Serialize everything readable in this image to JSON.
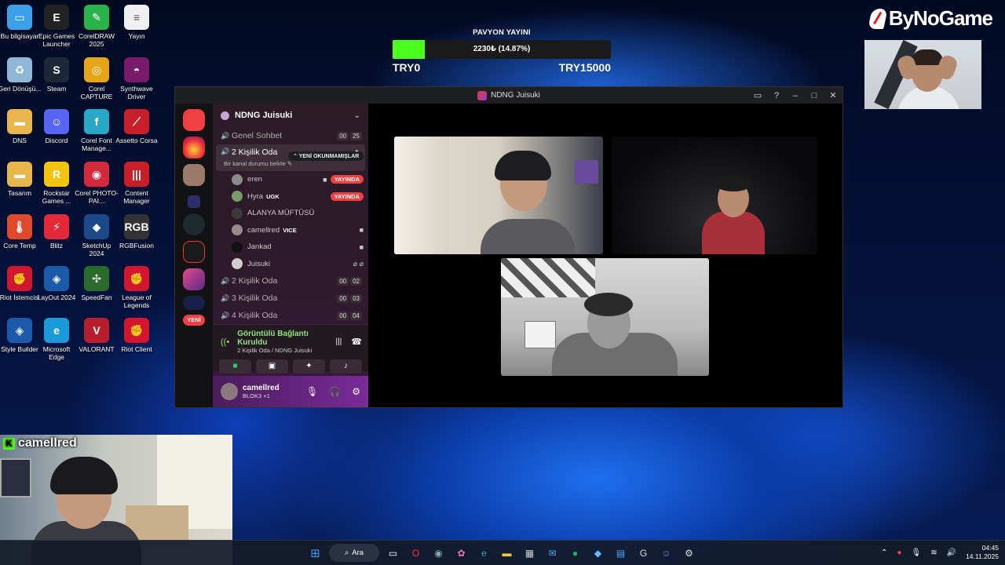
{
  "desktop_icons": [
    {
      "label": "Bu bilgisayar",
      "icon": "computer-icon",
      "color": "#3aa0e8"
    },
    {
      "label": "Epic Games Launcher",
      "icon": "epic-games-icon",
      "color": "#222222"
    },
    {
      "label": "CorelDRAW 2025",
      "icon": "coreldraw-icon",
      "color": "#29b34a"
    },
    {
      "label": "Yayın",
      "icon": "text-file-icon",
      "color": "#f0f0f0"
    },
    {
      "label": "Geri Dönüşü...",
      "icon": "recycle-bin-icon",
      "color": "#8fb8d8"
    },
    {
      "label": "Steam",
      "icon": "steam-icon",
      "color": "#1b2838"
    },
    {
      "label": "Corel CAPTURE",
      "icon": "corel-capture-icon",
      "color": "#e6a417"
    },
    {
      "label": "Synthwave Driver",
      "icon": "synthwave-icon",
      "color": "#7a1a6a"
    },
    {
      "label": "DNS",
      "icon": "folder-icon",
      "color": "#e8b64a"
    },
    {
      "label": "Discord",
      "icon": "discord-icon",
      "color": "#5865f2"
    },
    {
      "label": "Corel Font Manage...",
      "icon": "corel-font-icon",
      "color": "#2aa8c8"
    },
    {
      "label": "Assetto Corsa",
      "icon": "assetto-corsa-icon",
      "color": "#c8202a"
    },
    {
      "label": "Tasarım",
      "icon": "folder-icon",
      "color": "#e8b64a"
    },
    {
      "label": "Rockstar Games ...",
      "icon": "rockstar-icon",
      "color": "#f2c40f"
    },
    {
      "label": "Corel PHOTO-PAI...",
      "icon": "corel-photopaint-icon",
      "color": "#d22a3a"
    },
    {
      "label": "Content Manager",
      "icon": "content-manager-icon",
      "color": "#c81e28"
    },
    {
      "label": "Core Temp",
      "icon": "thermometer-icon",
      "color": "#e04a2a"
    },
    {
      "label": "Blitz",
      "icon": "blitz-icon",
      "color": "#e22a3a"
    },
    {
      "label": "SketchUp 2024",
      "icon": "sketchup-icon",
      "color": "#1a4a8a"
    },
    {
      "label": "RGBFusion",
      "icon": "rgbfusion-icon",
      "color": "#333333"
    },
    {
      "label": "Riot İstemcisi",
      "icon": "riot-icon",
      "color": "#d3162f"
    },
    {
      "label": "LayOut 2024",
      "icon": "layout-icon",
      "color": "#1a5aa8"
    },
    {
      "label": "SpeedFan",
      "icon": "speedfan-icon",
      "color": "#2a6a2a"
    },
    {
      "label": "League of Legends",
      "icon": "riot-icon",
      "color": "#d3162f"
    },
    {
      "label": "Style Builder",
      "icon": "style-builder-icon",
      "color": "#1a5aa8"
    },
    {
      "label": "Microsoft Edge",
      "icon": "edge-icon",
      "color": "#1a9ad8"
    },
    {
      "label": "VALORANT",
      "icon": "valorant-icon",
      "color": "#b81e2e"
    },
    {
      "label": "Riot Client",
      "icon": "riot-icon",
      "color": "#d3162f"
    }
  ],
  "donation": {
    "title": "PAVYON YAYINI",
    "value_text": "2230₺ (14.87%)",
    "progress": 0.1487,
    "min_label": "TRY0",
    "max_label": "TRY15000",
    "fill_color": "#4cff1f"
  },
  "brand": {
    "name": "ByNoGame"
  },
  "discord": {
    "window_title": "NDNG Juisuki",
    "server_new_badge": "YENİ",
    "guild_name": "NDNG Juisuki",
    "unread_pill": "YENİ OKUNMAMIŞLAR",
    "channels_top": [
      {
        "name": "Genel Sohbet",
        "count_a": "00",
        "count_b": "25"
      }
    ],
    "active_channel": {
      "name": "2 Kişilik Oda",
      "status_placeholder": "Bir kanal durumu belirle"
    },
    "members": [
      {
        "name": "eren",
        "tag": "",
        "badge": "YAYINDA",
        "camera": true
      },
      {
        "name": "Hyra",
        "tag": "UGK",
        "badge": "YAYINDA",
        "camera": false
      },
      {
        "name": "ALANYA MÜFTÜSÜ",
        "tag": "",
        "badge": "",
        "camera": false
      },
      {
        "name": "camellred",
        "tag": "VICE",
        "badge": "",
        "camera": true
      },
      {
        "name": "Jankad",
        "tag": "",
        "badge": "",
        "camera": true
      },
      {
        "name": "Juisuki",
        "tag": "",
        "badge": "",
        "camera": false
      }
    ],
    "channels_bottom": [
      {
        "name": "2 Kişilik Oda",
        "count_a": "00",
        "count_b": "02"
      },
      {
        "name": "3 Kişilik Oda",
        "count_a": "00",
        "count_b": "03"
      },
      {
        "name": "4 Kişilik Oda",
        "count_a": "00",
        "count_b": "04"
      }
    ],
    "voice": {
      "status": "Görüntülü Bağlantı Kuruldu",
      "location": "2 Kişilik Oda / NDNG Juisuki"
    },
    "user": {
      "name": "camellred",
      "sub": "BLOK3 +1"
    }
  },
  "stream_overlay": {
    "platform_icon": "kick-icon",
    "username": "camellred"
  },
  "taskbar": {
    "search_label": "Ara",
    "time": "04:45",
    "date": "14.11.2025"
  }
}
